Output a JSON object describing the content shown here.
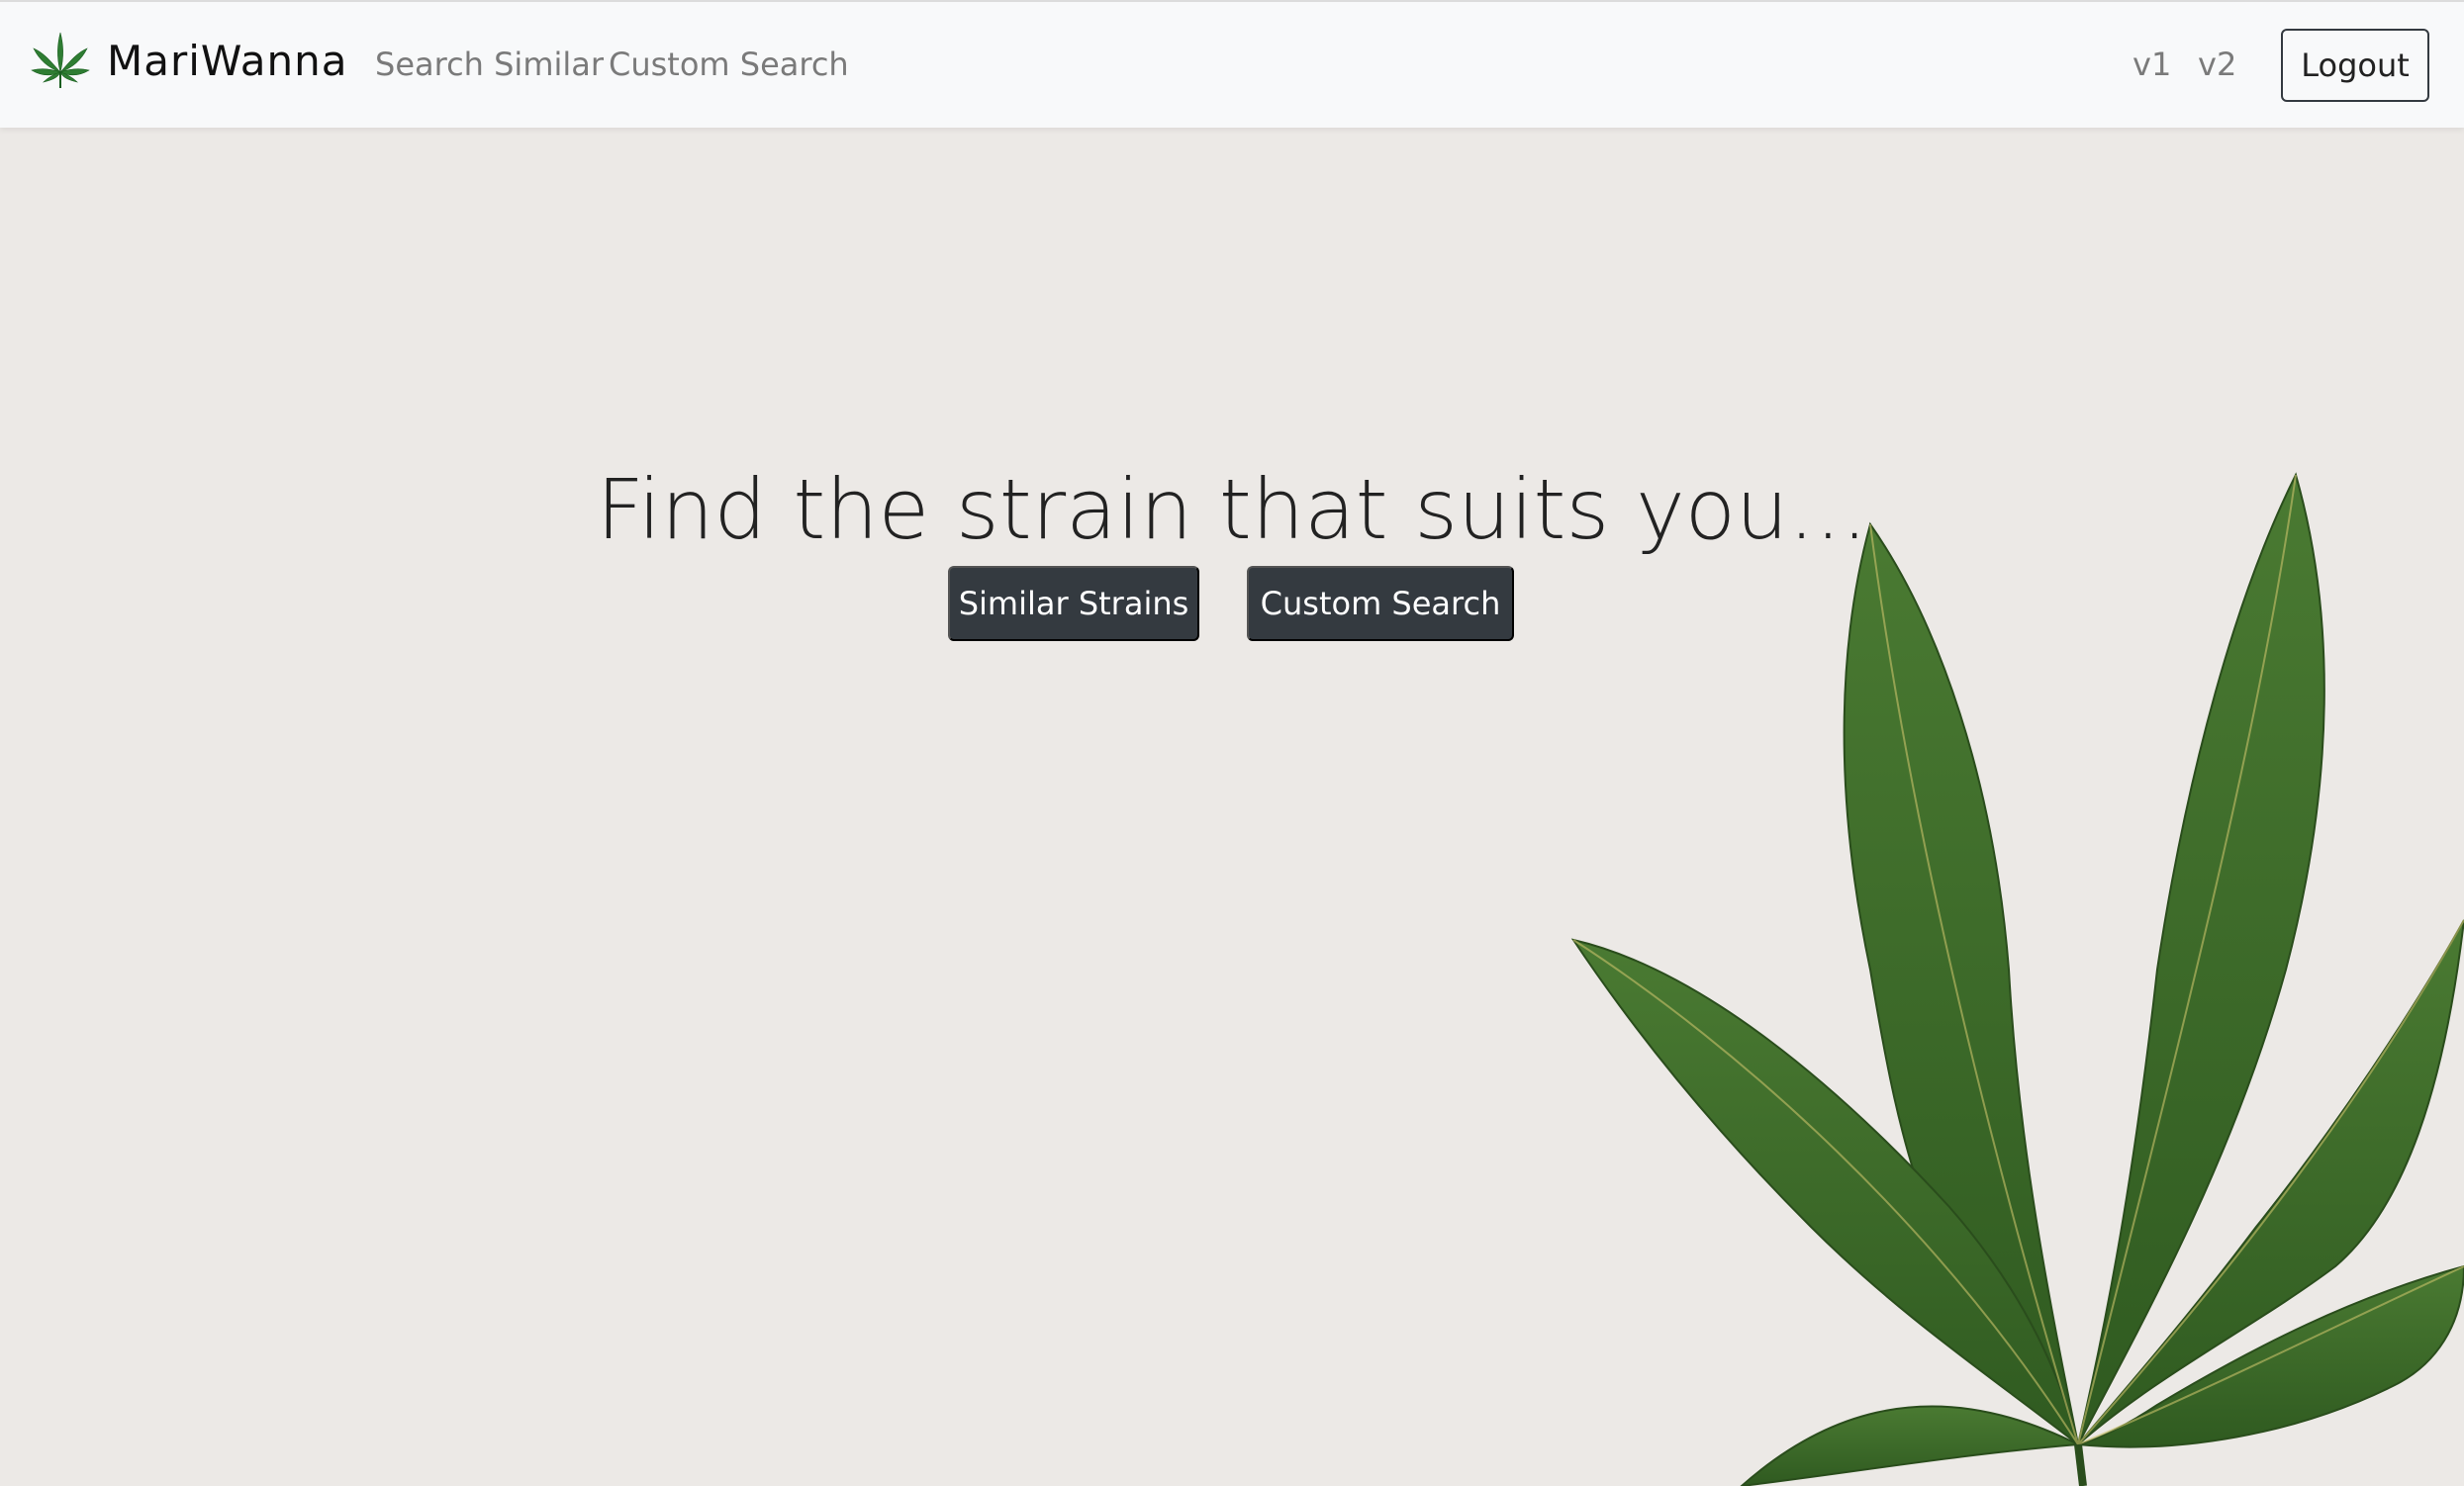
{
  "navbar": {
    "brand": {
      "logo_icon": "cannabis-leaf-icon",
      "name": "MariWanna"
    },
    "links": {
      "search_similar": "Search Similar",
      "custom_search": "Custom Search",
      "v1": "v1",
      "v2": "v2"
    },
    "logout_label": "Logout"
  },
  "hero": {
    "title": "Find the strain that suits you...",
    "buttons": {
      "similar_strains": "Similar Strains",
      "custom_search": "Custom Search"
    },
    "background_image": "cannabis-leaf"
  },
  "colors": {
    "page_background": "#ece9e6",
    "navbar_background": "#f8f9fa",
    "button_dark": "#343a40",
    "leaf_green": "#3f6b2a"
  }
}
